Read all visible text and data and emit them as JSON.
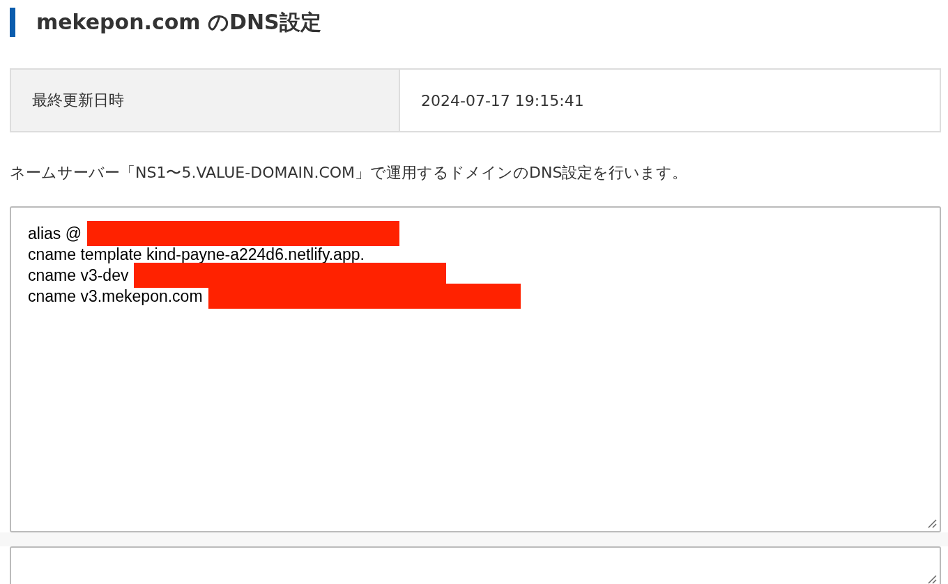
{
  "page": {
    "title": "mekepon.com のDNS設定"
  },
  "info_table": [
    {
      "label": "最終更新日時",
      "value": "2024-07-17 19:15:41"
    }
  ],
  "description": "ネームサーバー「NS1〜5.VALUE-DOMAIN.COM」で運用するドメインのDNS設定を行います。",
  "dns_records": [
    {
      "text": "alias @",
      "redacted": true
    },
    {
      "text": "cname template kind-payne-a224d6.netlify.app.",
      "redacted": false
    },
    {
      "text": "cname v3-dev",
      "redacted": true
    },
    {
      "text": "cname v3.mekepon.com",
      "redacted": true
    }
  ]
}
